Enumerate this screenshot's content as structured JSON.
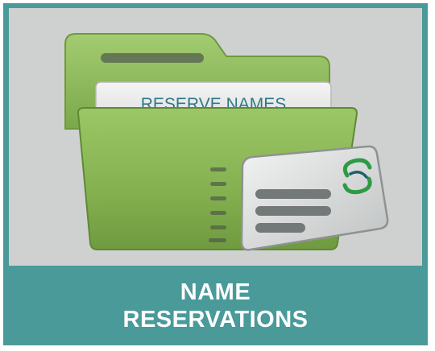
{
  "tile": {
    "label_line1": "NAME",
    "label_line2": "RESERVATIONS",
    "folder_tab_text": "RESERVE NAMES",
    "icons": [
      "folder-icon",
      "name-card-icon",
      "swirl-logo-icon"
    ]
  },
  "colors": {
    "tile_band": "#4a9a9a",
    "image_background": "#cfd1d1",
    "folder_green": "#8dbb57",
    "label_text": "#ffffff"
  }
}
